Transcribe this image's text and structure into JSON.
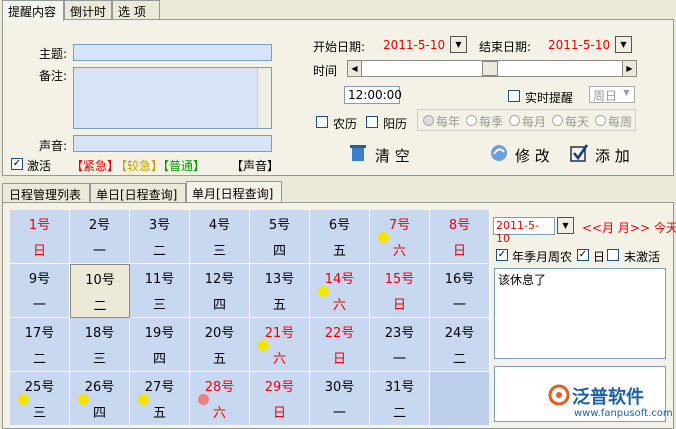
{
  "tabs": [
    "提醒内容",
    "倒计时",
    "选 项"
  ],
  "form": {
    "subject_label": "主题:",
    "note_label": "备注:",
    "sound_label": "声音:",
    "activate_label": "激活",
    "urgent": "【紧急】",
    "moderate": "【较急】",
    "normal": "【普通】",
    "sound_btn": "【声音】"
  },
  "dates": {
    "start_label": "开始日期:",
    "start_value": "2011-5-10",
    "end_label": "结束日期:",
    "end_value": "2011-5-10",
    "time_label": "时间",
    "time_value": "12:00:00",
    "realtime_label": "实时提醒",
    "weekday_value": "周日",
    "lunar_label": "农历",
    "solar_label": "阳历",
    "repeat": [
      "每年",
      "每季",
      "每月",
      "每天",
      "每周"
    ]
  },
  "actions": {
    "clear": "清 空",
    "modify": "修 改",
    "add": "添 加"
  },
  "viewtabs": [
    "日程管理列表",
    "单日[日程查询]",
    "单月[日程查询]"
  ],
  "calendar": {
    "days": [
      {
        "n": "1号",
        "w": "日"
      },
      {
        "n": "2号",
        "w": "一"
      },
      {
        "n": "3号",
        "w": "二"
      },
      {
        "n": "4号",
        "w": "三"
      },
      {
        "n": "5号",
        "w": "四"
      },
      {
        "n": "6号",
        "w": "五"
      },
      {
        "n": "7号",
        "w": "六"
      },
      {
        "n": "8号",
        "w": "日"
      },
      {
        "n": "9号",
        "w": "一"
      },
      {
        "n": "10号",
        "w": "二"
      },
      {
        "n": "11号",
        "w": "三"
      },
      {
        "n": "12号",
        "w": "四"
      },
      {
        "n": "13号",
        "w": "五"
      },
      {
        "n": "14号",
        "w": "六"
      },
      {
        "n": "15号",
        "w": "日"
      },
      {
        "n": "16号",
        "w": "一"
      },
      {
        "n": "17号",
        "w": "二"
      },
      {
        "n": "18号",
        "w": "三"
      },
      {
        "n": "19号",
        "w": "四"
      },
      {
        "n": "20号",
        "w": "五"
      },
      {
        "n": "21号",
        "w": "六"
      },
      {
        "n": "22号",
        "w": "日"
      },
      {
        "n": "23号",
        "w": "一"
      },
      {
        "n": "24号",
        "w": "二"
      },
      {
        "n": "25号",
        "w": "三"
      },
      {
        "n": "26号",
        "w": "四"
      },
      {
        "n": "27号",
        "w": "五"
      },
      {
        "n": "28号",
        "w": "六"
      },
      {
        "n": "29号",
        "w": "日"
      },
      {
        "n": "30号",
        "w": "一"
      },
      {
        "n": "31号",
        "w": "二"
      }
    ]
  },
  "side": {
    "date_value": "2011-5-10",
    "nav": "<<月  月>> 今天",
    "filter": "年季月周农",
    "day_label": "日",
    "inactive_label": "未激活",
    "note_text": "该休息了"
  },
  "brand": {
    "name": "泛普软件",
    "url": "www.fanpusoft.com"
  },
  "colors": {
    "red": "#E00000",
    "yellow": "#F5E400",
    "salmon": "#F08080"
  }
}
